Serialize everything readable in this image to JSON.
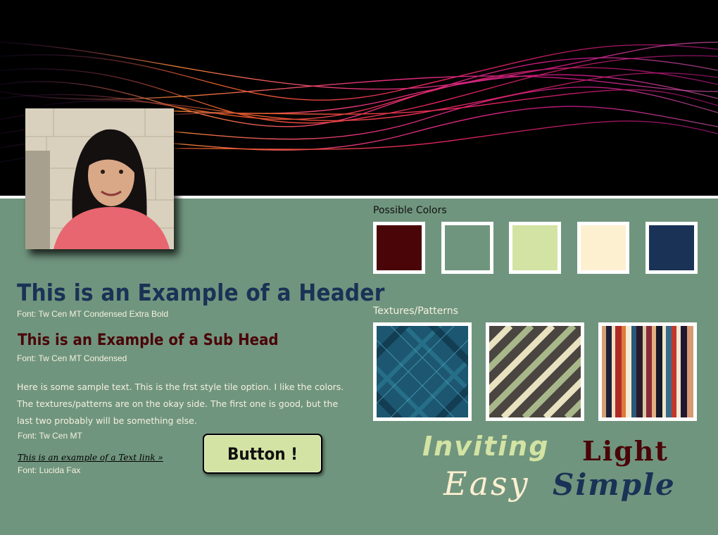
{
  "header": {
    "title": "This is an Example of a Header",
    "font": "Font: Tw Cen MT Condensed Extra Bold"
  },
  "subhead": {
    "title": "This is an Example of a Sub Head",
    "font": "Font: Tw Cen MT Condensed"
  },
  "body": {
    "text": "Here is some sample text. This is the frst style tile option. I like the colors. The textures/patterns are on the okay side. The first one is good, but the last two probably will be something else.",
    "font": "Font: Tw Cen MT"
  },
  "link": {
    "text": "This is an example of a Text link »",
    "font": "Font: Lucida Fax"
  },
  "button": {
    "label": "Button !"
  },
  "colors": {
    "label": "Possible Colors",
    "swatches": [
      "#4a0508",
      "#70957e",
      "#d2e3a3",
      "#fdf0d1",
      "#1a3256"
    ]
  },
  "textures": {
    "label": "Textures/Patterns",
    "items": [
      "plaid-texture",
      "diagonal-stripe-texture",
      "vertical-stripe-texture"
    ]
  },
  "adjectives": [
    "Inviting",
    "Light",
    "Easy",
    "Simple"
  ]
}
